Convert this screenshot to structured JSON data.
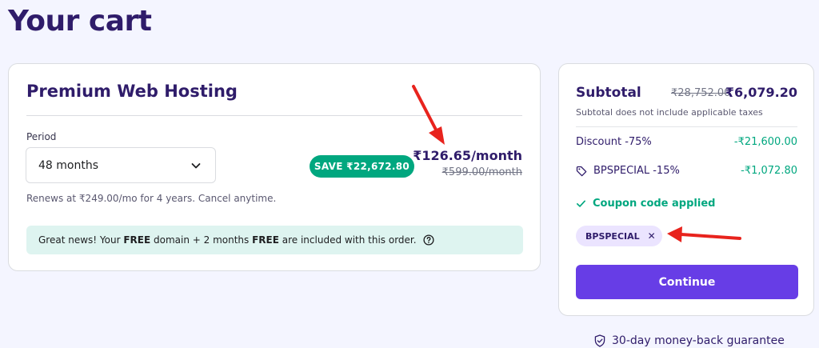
{
  "page": {
    "title": "Your cart"
  },
  "product": {
    "name": "Premium Web Hosting",
    "period_label": "Period",
    "period_value": "48 months",
    "renew_text": "Renews at ₹249.00/mo for 4 years. Cancel anytime.",
    "save_badge": "SAVE ₹22,672.80",
    "price": "₹126.65/month",
    "old_price": "₹599.00/month",
    "banner": {
      "prefix": "Great news! Your ",
      "free1": "FREE",
      "middle": " domain + 2 months ",
      "free2": "FREE",
      "suffix": " are included with this order."
    }
  },
  "summary": {
    "title": "Subtotal",
    "old_total": "₹28,752.00",
    "total": "₹6,079.20",
    "note": "Subtotal does not include applicable taxes",
    "discount_label": "Discount -75%",
    "discount_value": "-₹21,600.00",
    "coupon_label": "BPSPECIAL -15%",
    "coupon_value": "-₹1,072.80",
    "coupon_applied": "Coupon code applied",
    "coupon_chip": "BPSPECIAL",
    "chip_close": "✕",
    "continue_label": "Continue"
  },
  "guarantee": "30-day money-back guarantee",
  "colors": {
    "primary": "#673de6",
    "success": "#00a77f",
    "heading": "#2f1c6a",
    "annotation": "#e8231d",
    "background": "#f4f5ff"
  },
  "icons": {
    "period_select": "chevron-down-icon",
    "banner": "help-circle-icon",
    "coupon_row": "tag-icon",
    "coupon_applied": "check-icon",
    "chip": "close-icon",
    "guarantee": "shield-check-icon"
  }
}
